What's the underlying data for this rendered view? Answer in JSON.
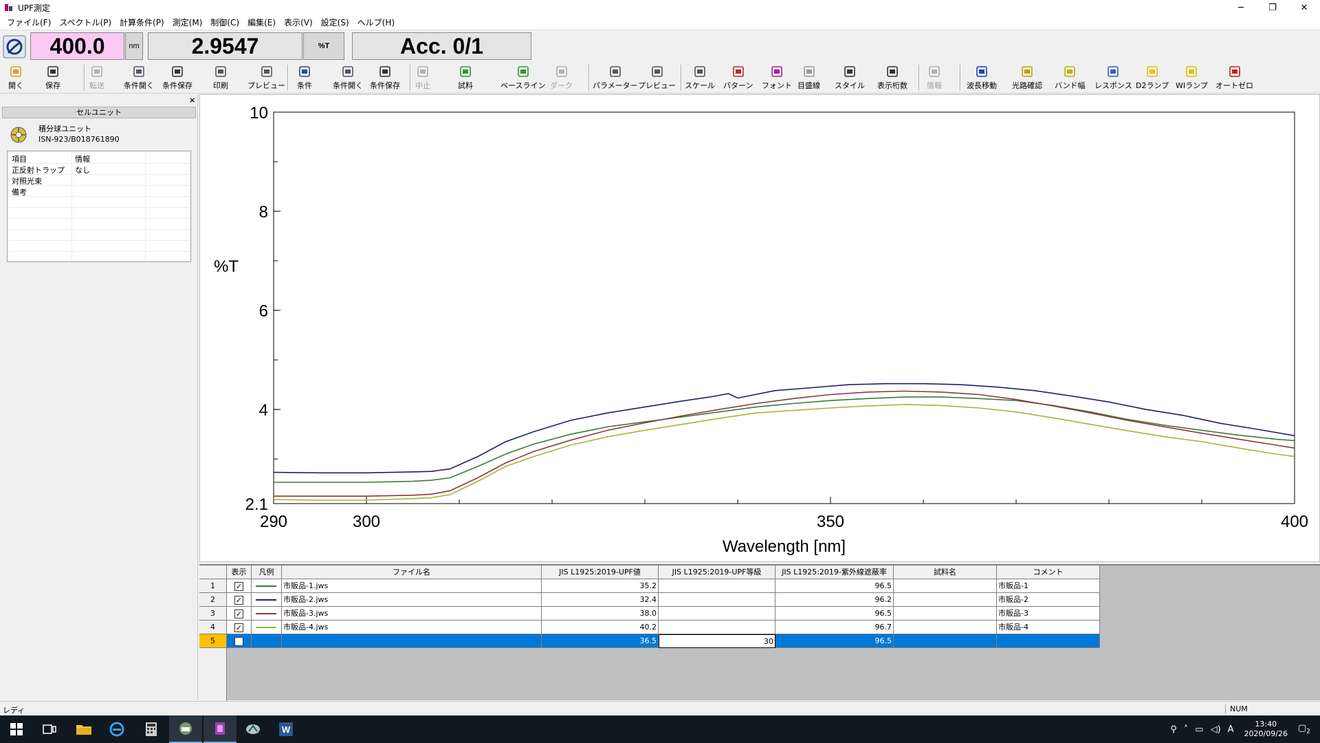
{
  "window": {
    "title": "UPF測定",
    "controls": [
      "─",
      "❐",
      "✕"
    ]
  },
  "menu": [
    "ファイル(F)",
    "スペクトル(P)",
    "計算条件(P)",
    "測定(M)",
    "制御(C)",
    "編集(E)",
    "表示(V)",
    "設定(S)",
    "ヘルプ(H)"
  ],
  "readout": {
    "wavelength": "400.0",
    "wavelength_unit": "nm",
    "value": "2.9547",
    "value_unit": "%T",
    "accumulation": "Acc. 0/1"
  },
  "toolbar": [
    {
      "label": "開く",
      "icon": "folder-open-icon",
      "enabled": true
    },
    {
      "label": "保存",
      "icon": "save-icon",
      "enabled": true
    },
    {
      "label": "転送",
      "icon": "transfer-icon",
      "enabled": false
    },
    {
      "label": "条件開く",
      "icon": "open-conditions-icon",
      "enabled": true
    },
    {
      "label": "条件保存",
      "icon": "save-conditions-icon",
      "enabled": true
    },
    {
      "label": "印刷",
      "icon": "printer-icon",
      "enabled": true
    },
    {
      "label": "プレビュー",
      "icon": "print-preview-icon",
      "enabled": true
    },
    {
      "label": "条件",
      "icon": "conditions-icon",
      "enabled": true
    },
    {
      "label": "条件開く",
      "icon": "open-conditions-icon",
      "enabled": true
    },
    {
      "label": "条件保存",
      "icon": "save-conditions-icon",
      "enabled": true
    },
    {
      "label": "中止",
      "icon": "stop-icon",
      "enabled": false
    },
    {
      "label": "試料",
      "icon": "sample-icon",
      "enabled": true
    },
    {
      "label": "ベースライン",
      "icon": "baseline-icon",
      "enabled": true
    },
    {
      "label": "ダーク",
      "icon": "dark-icon",
      "enabled": false
    },
    {
      "label": "パラメーター",
      "icon": "parameter-icon",
      "enabled": true
    },
    {
      "label": "プレビュー",
      "icon": "preview-icon",
      "enabled": true
    },
    {
      "label": "スケール",
      "icon": "scale-icon",
      "enabled": true
    },
    {
      "label": "パターン",
      "icon": "pattern-icon",
      "enabled": true
    },
    {
      "label": "フォント",
      "icon": "font-icon",
      "enabled": true
    },
    {
      "label": "目盛線",
      "icon": "gridline-icon",
      "enabled": true
    },
    {
      "label": "スタイル",
      "icon": "style-icon",
      "enabled": true
    },
    {
      "label": "表示桁数",
      "icon": "digits-icon",
      "enabled": true
    },
    {
      "label": "情報",
      "icon": "info-icon",
      "enabled": false
    },
    {
      "label": "波長移動",
      "icon": "wavelength-move-icon",
      "enabled": true
    },
    {
      "label": "光路確認",
      "icon": "light-path-icon",
      "enabled": true
    },
    {
      "label": "バンド幅",
      "icon": "bandwidth-icon",
      "enabled": true
    },
    {
      "label": "レスポンス",
      "icon": "response-icon",
      "enabled": true
    },
    {
      "label": "D2ランプ",
      "icon": "d2-lamp-icon",
      "enabled": true
    },
    {
      "label": "WIランプ",
      "icon": "wi-lamp-icon",
      "enabled": true
    },
    {
      "label": "オートゼロ",
      "icon": "auto-zero-icon",
      "enabled": true
    }
  ],
  "left_panel": {
    "close_glyph": "×",
    "header": "セルユニット",
    "unit_name": "積分球ユニット",
    "unit_serial": "ISN-923/B018761890",
    "table": [
      [
        "項目",
        "情報"
      ],
      [
        "正反射トラップ",
        "なし"
      ],
      [
        "対照光束",
        ""
      ],
      [
        "備考",
        ""
      ]
    ]
  },
  "chart_data": {
    "type": "line",
    "xlabel": "Wavelength [nm]",
    "ylabel": "%T",
    "xlim": [
      290,
      400
    ],
    "ylim": [
      2.1,
      10
    ],
    "x_ticks": [
      290,
      300,
      350,
      400
    ],
    "y_ticks": [
      2.1,
      4,
      6,
      8,
      10
    ],
    "grid": false,
    "series": [
      {
        "color": "#1f1f6e",
        "x": [
          290,
          295,
          300,
          305,
          307,
          309,
          312,
          315,
          318,
          322,
          326,
          330,
          334,
          337,
          339,
          340,
          344,
          348,
          352,
          356,
          360,
          364,
          368,
          372,
          376,
          380,
          384,
          388,
          392,
          396,
          400
        ],
        "y": [
          2.73,
          2.72,
          2.72,
          2.74,
          2.75,
          2.8,
          3.05,
          3.35,
          3.55,
          3.78,
          3.93,
          4.05,
          4.17,
          4.25,
          4.32,
          4.23,
          4.38,
          4.44,
          4.5,
          4.52,
          4.52,
          4.5,
          4.45,
          4.38,
          4.27,
          4.15,
          4.0,
          3.88,
          3.72,
          3.6,
          3.47
        ]
      },
      {
        "color": "#3b7a3b",
        "x": [
          290,
          295,
          300,
          305,
          307,
          309,
          312,
          315,
          318,
          322,
          326,
          330,
          334,
          338,
          342,
          346,
          350,
          354,
          358,
          362,
          366,
          370,
          374,
          378,
          382,
          386,
          390,
          394,
          398,
          400
        ],
        "y": [
          2.53,
          2.53,
          2.53,
          2.55,
          2.57,
          2.62,
          2.85,
          3.1,
          3.3,
          3.5,
          3.65,
          3.75,
          3.85,
          3.95,
          4.05,
          4.12,
          4.18,
          4.22,
          4.25,
          4.25,
          4.22,
          4.18,
          4.08,
          3.95,
          3.8,
          3.68,
          3.58,
          3.48,
          3.4,
          3.37
        ]
      },
      {
        "color": "#8b3a3a",
        "x": [
          290,
          295,
          300,
          305,
          307,
          309,
          312,
          315,
          318,
          322,
          326,
          330,
          334,
          338,
          342,
          346,
          350,
          354,
          358,
          362,
          366,
          370,
          374,
          378,
          382,
          386,
          390,
          394,
          398,
          400
        ],
        "y": [
          2.25,
          2.25,
          2.25,
          2.27,
          2.29,
          2.36,
          2.62,
          2.92,
          3.15,
          3.38,
          3.58,
          3.73,
          3.87,
          4.0,
          4.12,
          4.22,
          4.3,
          4.35,
          4.37,
          4.35,
          4.3,
          4.2,
          4.07,
          3.93,
          3.78,
          3.65,
          3.52,
          3.4,
          3.28,
          3.22
        ]
      },
      {
        "color": "#a4b53a",
        "x": [
          290,
          295,
          300,
          305,
          307,
          309,
          312,
          315,
          318,
          322,
          326,
          330,
          334,
          338,
          342,
          346,
          350,
          354,
          358,
          362,
          366,
          370,
          374,
          378,
          382,
          386,
          390,
          394,
          398,
          400
        ],
        "y": [
          2.18,
          2.17,
          2.17,
          2.2,
          2.22,
          2.28,
          2.55,
          2.85,
          3.05,
          3.28,
          3.45,
          3.58,
          3.7,
          3.82,
          3.93,
          3.98,
          4.03,
          4.07,
          4.1,
          4.08,
          4.03,
          3.95,
          3.83,
          3.7,
          3.57,
          3.45,
          3.35,
          3.22,
          3.1,
          3.05
        ]
      }
    ]
  },
  "grid": {
    "columns": [
      "表示",
      "凡例",
      "ファイル名",
      "JIS L1925:2019-UPF値",
      "JIS L1925:2019-UPF等級",
      "JIS L1925:2019-紫外線遮蔽率",
      "試料名",
      "コメント"
    ],
    "rows": [
      {
        "num": "1",
        "checked": true,
        "legend_color": "#3b7a3b",
        "file": "市販品-1.jws",
        "upf": "35.2",
        "grade": "",
        "shield": "96.5",
        "sample": "",
        "comment": "市販品-1"
      },
      {
        "num": "2",
        "checked": true,
        "legend_color": "#1f1f6e",
        "file": "市販品-2.jws",
        "upf": "32.4",
        "grade": "",
        "shield": "96.2",
        "sample": "",
        "comment": "市販品-2"
      },
      {
        "num": "3",
        "checked": true,
        "legend_color": "#8b3a3a",
        "file": "市販品-3.jws",
        "upf": "38.0",
        "grade": "",
        "shield": "96.5",
        "sample": "",
        "comment": "市販品-3"
      },
      {
        "num": "4",
        "checked": true,
        "legend_color": "#a4b53a",
        "file": "市販品-4.jws",
        "upf": "40.2",
        "grade": "",
        "shield": "96.7",
        "sample": "",
        "comment": "市販品-4"
      },
      {
        "num": "5",
        "checked": false,
        "legend_color": "",
        "file": "",
        "upf": "36.5",
        "grade": "30",
        "shield": "96.5",
        "sample": "",
        "comment": ""
      }
    ],
    "check_glyph": "✓"
  },
  "status": {
    "left": "レディ",
    "right": "NUM"
  },
  "taskbar": {
    "time": "13:40",
    "date": "2020/09/26",
    "ime": "A",
    "notification_count": "2"
  }
}
